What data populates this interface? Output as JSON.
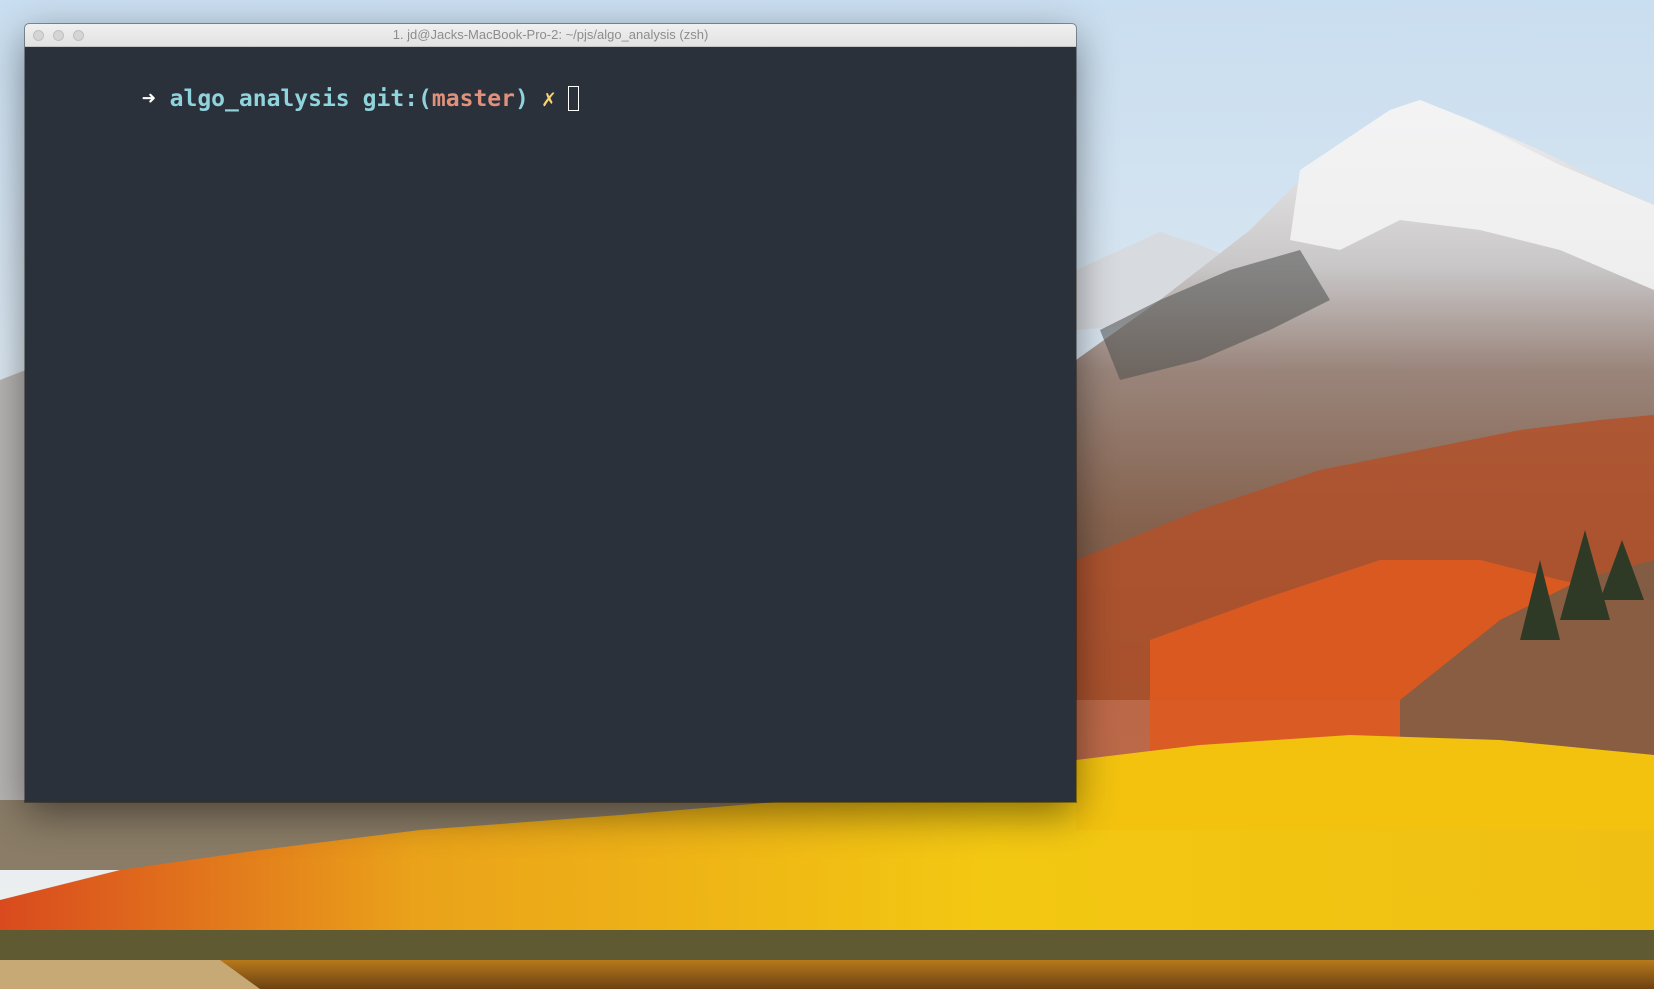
{
  "window": {
    "title": "1. jd@Jacks-MacBook-Pro-2: ~/pjs/algo_analysis (zsh)"
  },
  "terminal": {
    "prompt": {
      "arrow": "➜",
      "directory": "algo_analysis",
      "git_label": "git:",
      "paren_open": "(",
      "branch": "master",
      "paren_close": ")",
      "dirty_marker": "✗"
    },
    "input_value": ""
  },
  "colors": {
    "terminal_background": "#2b313b",
    "arrow": "#ffffff",
    "directory": "#8fd3dc",
    "git_label": "#8fd3dc",
    "branch": "#e0917b",
    "dirty_marker": "#f5d36e",
    "cursor": "#ffffff",
    "titlebar": "#e8e8e8",
    "title_text": "#8d8d8d"
  },
  "desktop": {
    "wallpaper": "macOS High Sierra mountain landscape"
  }
}
